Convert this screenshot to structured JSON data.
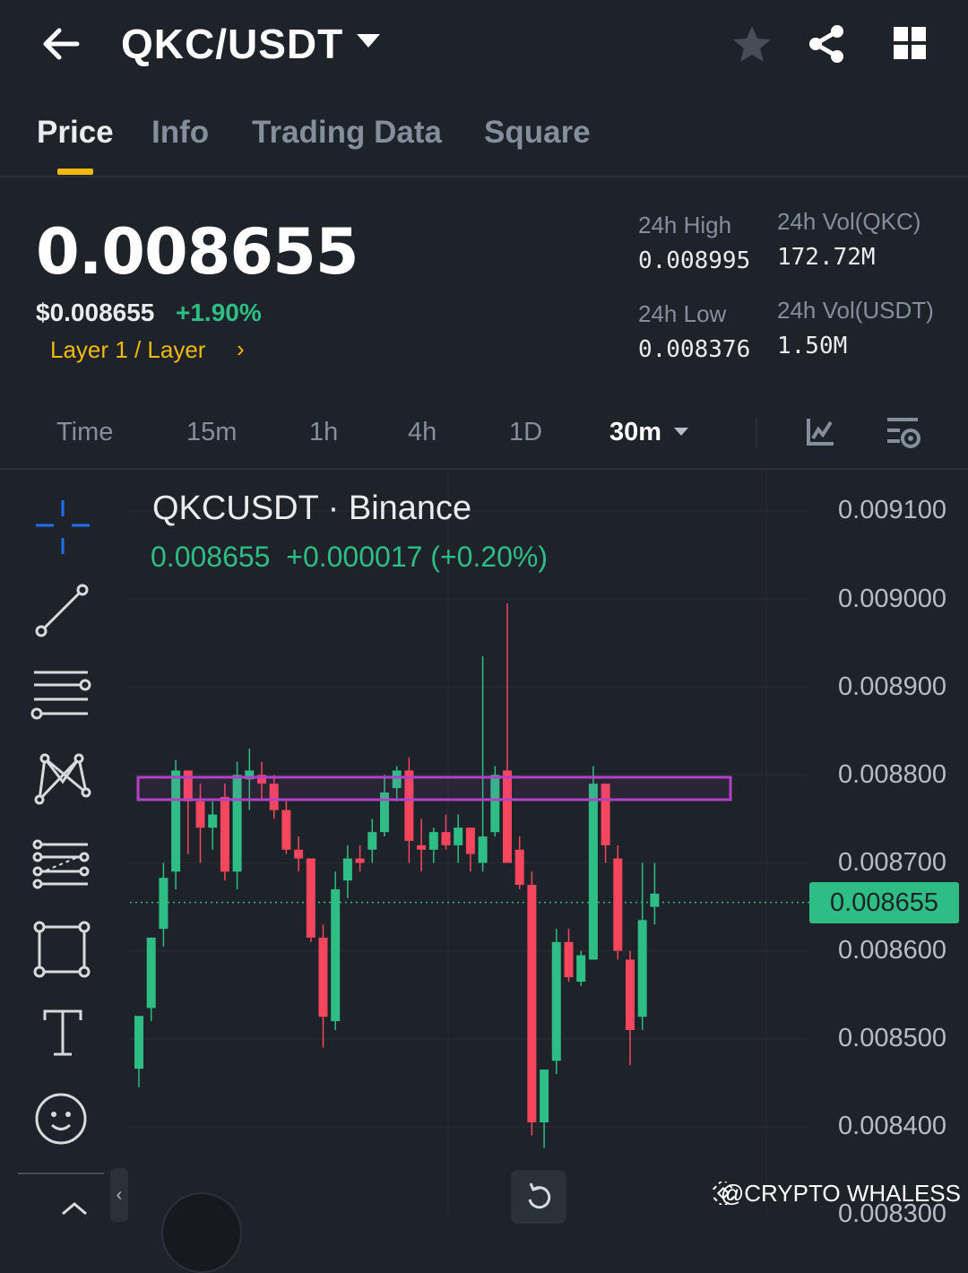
{
  "header": {
    "title": "QKC/USDT"
  },
  "tabs": [
    {
      "label": "Price"
    },
    {
      "label": "Info"
    },
    {
      "label": "Trading Data"
    },
    {
      "label": "Square"
    }
  ],
  "price": {
    "last": "0.008655",
    "usd": "$0.008655",
    "change": "+1.90%",
    "tag": "Layer 1 / Layer"
  },
  "stats": {
    "high_label": "24h High",
    "high": "0.008995",
    "low_label": "24h Low",
    "low": "0.008376",
    "vol_base_label": "24h Vol(QKC)",
    "vol_base": "172.72M",
    "vol_quote_label": "24h Vol(USDT)",
    "vol_quote": "1.50M"
  },
  "intervals": [
    "Time",
    "15m",
    "1h",
    "4h",
    "1D"
  ],
  "active_interval": "30m",
  "chart": {
    "symbol": "QKCUSDT · Binance",
    "quote_line": "0.008655  +0.000017 (+0.20%)",
    "current_price": "0.008655",
    "axis_labels": [
      "0.009100",
      "0.009000",
      "0.008900",
      "0.008800",
      "0.008700",
      "0.008600",
      "0.008500",
      "0.008400",
      "0.008300"
    ]
  },
  "chart_data": {
    "type": "candlestick",
    "ylim": [
      0.0083,
      0.0091
    ],
    "candles": [
      {
        "o": 0.008466,
        "h": 0.008503,
        "l": 0.008445,
        "c": 0.008526
      },
      {
        "o": 0.008535,
        "h": 0.008612,
        "l": 0.00852,
        "c": 0.008615
      },
      {
        "o": 0.008625,
        "h": 0.0087,
        "l": 0.008605,
        "c": 0.008683
      },
      {
        "o": 0.00869,
        "h": 0.008817,
        "l": 0.00867,
        "c": 0.008805
      },
      {
        "o": 0.008805,
        "h": 0.008794,
        "l": 0.00871,
        "c": 0.00877
      },
      {
        "o": 0.00877,
        "h": 0.00879,
        "l": 0.0087,
        "c": 0.00874
      },
      {
        "o": 0.00874,
        "h": 0.00877,
        "l": 0.008715,
        "c": 0.008755
      },
      {
        "o": 0.008775,
        "h": 0.00879,
        "l": 0.00868,
        "c": 0.00869
      },
      {
        "o": 0.00869,
        "h": 0.008815,
        "l": 0.00867,
        "c": 0.0088
      },
      {
        "o": 0.008795,
        "h": 0.00883,
        "l": 0.00876,
        "c": 0.008805
      },
      {
        "o": 0.0088,
        "h": 0.008815,
        "l": 0.00877,
        "c": 0.00879
      },
      {
        "o": 0.00879,
        "h": 0.0088,
        "l": 0.00875,
        "c": 0.00876
      },
      {
        "o": 0.00876,
        "h": 0.00877,
        "l": 0.00871,
        "c": 0.008715
      },
      {
        "o": 0.008715,
        "h": 0.00873,
        "l": 0.00869,
        "c": 0.008705
      },
      {
        "o": 0.008705,
        "h": 0.0087,
        "l": 0.00861,
        "c": 0.008615
      },
      {
        "o": 0.008615,
        "h": 0.00863,
        "l": 0.00849,
        "c": 0.008525
      },
      {
        "o": 0.00852,
        "h": 0.00869,
        "l": 0.00851,
        "c": 0.00867
      },
      {
        "o": 0.00868,
        "h": 0.00872,
        "l": 0.00866,
        "c": 0.008705
      },
      {
        "o": 0.008705,
        "h": 0.00872,
        "l": 0.00869,
        "c": 0.0087
      },
      {
        "o": 0.008715,
        "h": 0.00875,
        "l": 0.0087,
        "c": 0.008735
      },
      {
        "o": 0.008735,
        "h": 0.0088,
        "l": 0.00873,
        "c": 0.00878
      },
      {
        "o": 0.008785,
        "h": 0.00881,
        "l": 0.00877,
        "c": 0.008805
      },
      {
        "o": 0.008805,
        "h": 0.00882,
        "l": 0.0087,
        "c": 0.008725
      },
      {
        "o": 0.00872,
        "h": 0.00875,
        "l": 0.00869,
        "c": 0.008715
      },
      {
        "o": 0.008715,
        "h": 0.00874,
        "l": 0.0087,
        "c": 0.008735
      },
      {
        "o": 0.008735,
        "h": 0.008755,
        "l": 0.008715,
        "c": 0.00872
      },
      {
        "o": 0.00872,
        "h": 0.008755,
        "l": 0.0087,
        "c": 0.00874
      },
      {
        "o": 0.00874,
        "h": 0.00874,
        "l": 0.00869,
        "c": 0.00871
      },
      {
        "o": 0.0087,
        "h": 0.008935,
        "l": 0.00869,
        "c": 0.00873
      },
      {
        "o": 0.008735,
        "h": 0.00881,
        "l": 0.00873,
        "c": 0.0088
      },
      {
        "o": 0.008805,
        "h": 0.008995,
        "l": 0.0087,
        "c": 0.0087
      },
      {
        "o": 0.008715,
        "h": 0.00873,
        "l": 0.00867,
        "c": 0.008675
      },
      {
        "o": 0.008675,
        "h": 0.00869,
        "l": 0.00839,
        "c": 0.008405
      },
      {
        "o": 0.008405,
        "h": 0.00844,
        "l": 0.008376,
        "c": 0.008465
      },
      {
        "o": 0.008475,
        "h": 0.008625,
        "l": 0.00846,
        "c": 0.00861
      },
      {
        "o": 0.00861,
        "h": 0.008625,
        "l": 0.008565,
        "c": 0.00857
      },
      {
        "o": 0.008565,
        "h": 0.0086,
        "l": 0.00856,
        "c": 0.008595
      },
      {
        "o": 0.00859,
        "h": 0.00881,
        "l": 0.00859,
        "c": 0.00879
      },
      {
        "o": 0.00879,
        "h": 0.00879,
        "l": 0.0087,
        "c": 0.00872
      },
      {
        "o": 0.008705,
        "h": 0.00872,
        "l": 0.00859,
        "c": 0.0086
      },
      {
        "o": 0.00859,
        "h": 0.0086,
        "l": 0.00847,
        "c": 0.00851
      },
      {
        "o": 0.008525,
        "h": 0.0087,
        "l": 0.00851,
        "c": 0.008635
      },
      {
        "o": 0.00865,
        "h": 0.0087,
        "l": 0.00863,
        "c": 0.008665
      }
    ]
  },
  "watermark": "@CRYPTO WHALESS",
  "colors": {
    "up": "#2ebd85",
    "down": "#f6465d",
    "accent": "#f0b90b",
    "zone": "#b240c9",
    "bg": "#1e2329"
  },
  "icons": [
    "back-arrow-icon",
    "star-icon",
    "share-icon",
    "grid-icon",
    "crosshair-icon",
    "trendline-icon",
    "horizontal-lines-icon",
    "pattern-icon",
    "fib-icon",
    "rectangle-icon",
    "text-icon",
    "emoji-icon",
    "reset-icon",
    "chart-type-icon",
    "indicator-settings-icon"
  ]
}
